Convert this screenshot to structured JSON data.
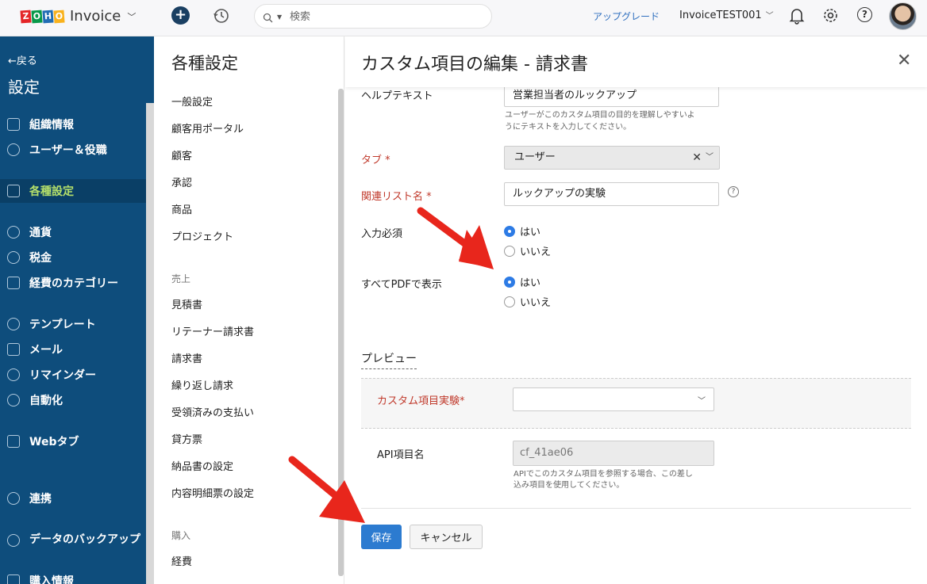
{
  "topbar": {
    "brand_letters": [
      "Z",
      "O",
      "H",
      "O"
    ],
    "brand_colors": [
      "#e42527",
      "#089949",
      "#226db4",
      "#f9b21d"
    ],
    "app_name": "Invoice",
    "search_placeholder": "検索",
    "upgrade_label": "アップグレード",
    "org_name": "InvoiceTEST001",
    "help_glyph": "?"
  },
  "leftnav": {
    "back_label": "←戻る",
    "title": "設定",
    "items": [
      {
        "label": "組織情報",
        "icon": "building-icon"
      },
      {
        "label": "ユーザー＆役職",
        "icon": "users-icon"
      },
      {
        "label": "各種設定",
        "icon": "sliders-icon",
        "active": true
      },
      {
        "label": "通貨",
        "icon": "currency-icon"
      },
      {
        "label": "税金",
        "icon": "percent-icon"
      },
      {
        "label": "経費のカテゴリー",
        "icon": "tree-icon"
      },
      {
        "label": "テンプレート",
        "icon": "palette-icon"
      },
      {
        "label": "メール",
        "icon": "mail-icon"
      },
      {
        "label": "リマインダー",
        "icon": "bell-icon"
      },
      {
        "label": "自動化",
        "icon": "refresh-icon"
      },
      {
        "label": "Webタブ",
        "icon": "window-icon"
      },
      {
        "label": "連携",
        "icon": "plug-icon"
      },
      {
        "label": "データのバックアップ",
        "icon": "database-icon"
      },
      {
        "label": "購入情報",
        "icon": "cart-icon"
      }
    ]
  },
  "settings": {
    "title": "各種設定",
    "items": [
      "一般設定",
      "顧客用ポータル",
      "顧客",
      "承認",
      "商品",
      "プロジェクト"
    ],
    "section_sales": "売上",
    "sales_items": [
      "見積書",
      "リテーナー請求書",
      "請求書",
      "繰り返し請求",
      "受領済みの支払い",
      "貸方票",
      "納品書の設定",
      "内容明細票の設定"
    ],
    "section_purchase": "購入",
    "purchase_items": [
      "経費"
    ]
  },
  "main": {
    "title": "カスタム項目の編集 - 請求書",
    "close_glyph": "✕",
    "help_text_label": "ヘルプテキスト",
    "help_text_value": "営業担当者のルックアップ",
    "help_text_hint_1": "ユーザーがこのカスタム項目の目的を理解しやすいよ",
    "help_text_hint_2": "うにテキストを入力してください。",
    "tab_label": "タブ *",
    "tab_value": "ユーザー",
    "related_list_label": "関連リスト名 *",
    "related_list_value": "ルックアップの実験",
    "required_label": "入力必須",
    "required_options": [
      "はい",
      "いいえ"
    ],
    "required_selected": "はい",
    "pdf_label": "すべてPDFで表示",
    "pdf_options": [
      "はい",
      "いいえ"
    ],
    "pdf_selected": "はい",
    "preview_label": "プレビュー",
    "preview_field_label": "カスタム項目実験*",
    "preview_field_value": "",
    "api_label": "API項目名",
    "api_value": "cf_41ae06",
    "api_hint_1": "APIでこのカスタム項目を参照する場合、この差し",
    "api_hint_2": "込み項目を使用してください。",
    "save_label": "保存",
    "cancel_label": "キャンセル"
  },
  "colors": {
    "nav_bg": "#0e4d7c",
    "nav_active_text": "#b5e06a",
    "required_label": "#c0392b",
    "primary_button": "#2c7bd0",
    "radio_selected": "#2d7be5",
    "annotation_arrow": "#e8261c"
  }
}
